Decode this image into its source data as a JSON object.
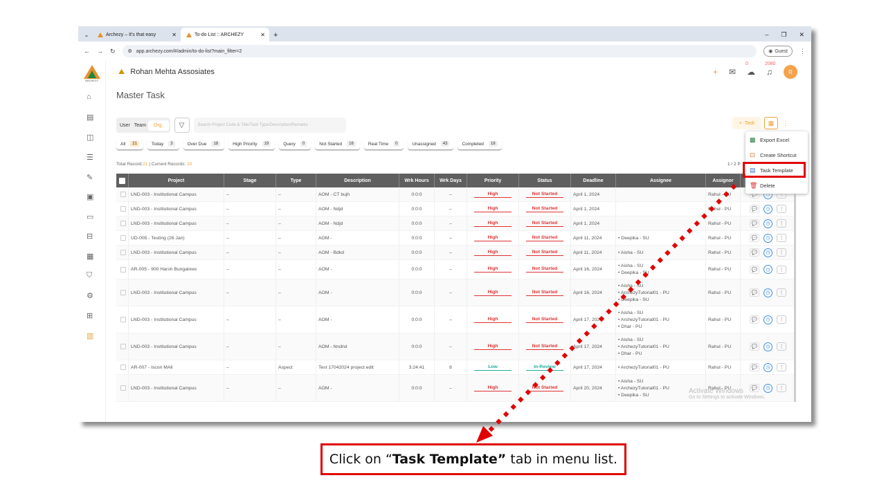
{
  "browser": {
    "tabs": [
      {
        "label": "Archezy – It's that easy",
        "active": false
      },
      {
        "label": "To-do List :: ARCHEZY",
        "active": true
      }
    ],
    "url": "app.archezy.com/#/admin/to-do-list?main_filter=2",
    "profile_label": "Guest"
  },
  "app": {
    "logo_text": "ARCHEZY",
    "company": "Rohan Mehta Assosiates",
    "notif_count": "0",
    "bell_count": "2080",
    "avatar_letter": "R"
  },
  "page": {
    "title": "Master Task",
    "scope_toggle": [
      "User",
      "Team",
      "Org."
    ],
    "search_placeholder": "Search Project Code & Title/Task Type/Description/Remarks",
    "chips": [
      {
        "label": "All",
        "count": "21"
      },
      {
        "label": "Today",
        "count": "3"
      },
      {
        "label": "Over Due",
        "count": "18"
      },
      {
        "label": "High Priority",
        "count": "19"
      },
      {
        "label": "Query",
        "count": "0"
      },
      {
        "label": "Not Started",
        "count": "16"
      },
      {
        "label": "Real Time",
        "count": "0"
      },
      {
        "label": "Unassigned",
        "count": "43"
      },
      {
        "label": "Completed",
        "count": "18"
      }
    ],
    "total_label": "Total Record:",
    "total_value": "21",
    "current_label": " | Current Records: ",
    "current_value": "20",
    "pager": "1 / 2 P",
    "task_button": "Task"
  },
  "menu": {
    "items": [
      {
        "label": "Export Excel",
        "icon": "excel-icon"
      },
      {
        "label": "Create Shortcut",
        "icon": "shortcut-icon"
      },
      {
        "label": "Task Template",
        "icon": "template-icon"
      },
      {
        "label": "Delete",
        "icon": "trash-icon"
      }
    ]
  },
  "table": {
    "headers": [
      "Project",
      "Stage",
      "Type",
      "Description",
      "Wrk Hours",
      "Wrk Days",
      "Priority",
      "Status",
      "Deadline",
      "Assignee",
      "Assignor"
    ],
    "rows": [
      {
        "project": "LND-003 - Institutional Campus",
        "stage": "–",
        "type": "–",
        "desc": "AOM - CT bujh",
        "hours": "0:0:0",
        "days": "–",
        "priority": "High",
        "status": "Not Started",
        "deadline": "April 1, 2024",
        "assignee": [],
        "assignor": "Rahul - PU"
      },
      {
        "project": "LND-003 - Institutional Campus",
        "stage": "–",
        "type": "–",
        "desc": "AOM - Ndjd",
        "hours": "0:0:0",
        "days": "–",
        "priority": "High",
        "status": "Not Started",
        "deadline": "April 1, 2024",
        "assignee": [],
        "assignor": "Rahul - PU"
      },
      {
        "project": "LND-003 - Institutional Campus",
        "stage": "–",
        "type": "–",
        "desc": "AOM - Ndjd",
        "hours": "0:0:0",
        "days": "–",
        "priority": "High",
        "status": "Not Started",
        "deadline": "April 1, 2024",
        "assignee": [],
        "assignor": "Rahul - PU"
      },
      {
        "project": "UD-005 - Testing (26 Jan)",
        "stage": "–",
        "type": "–",
        "desc": "AOM -",
        "hours": "0:0:0",
        "days": "–",
        "priority": "High",
        "status": "Not Started",
        "deadline": "April 11, 2024",
        "assignee": [
          "Deepika - SU"
        ],
        "assignor": "Rahul - PU"
      },
      {
        "project": "LND-003 - Institutional Campus",
        "stage": "–",
        "type": "–",
        "desc": "AOM - Bdkd",
        "hours": "0:0:0",
        "days": "–",
        "priority": "High",
        "status": "Not Started",
        "deadline": "April 11, 2024",
        "assignee": [
          "Aisha - SU"
        ],
        "assignor": "Rahul - PU"
      },
      {
        "project": "AR-005 - 900 Harsh Bungalows",
        "stage": "–",
        "type": "–",
        "desc": "AOM -",
        "hours": "0:0:0",
        "days": "–",
        "priority": "High",
        "status": "Not Started",
        "deadline": "April 16, 2024",
        "assignee": [
          "Aisha - SU",
          "Deepika - SU"
        ],
        "assignor": "Rahul - PU"
      },
      {
        "project": "LND-003 - Institutional Campus",
        "stage": "–",
        "type": "–",
        "desc": "AOM -",
        "hours": "0:0:0",
        "days": "–",
        "priority": "High",
        "status": "Not Started",
        "deadline": "April 16, 2024",
        "assignee": [
          "Aisha - SU",
          "ArchezyTutorial01 - PU",
          "Deepika - SU"
        ],
        "assignor": "Rahul - PU"
      },
      {
        "project": "LND-003 - Institutional Campus",
        "stage": "–",
        "type": "–",
        "desc": "AOM -",
        "hours": "0:0:0",
        "days": "–",
        "priority": "High",
        "status": "Not Started",
        "deadline": "April 17, 2024",
        "assignee": [
          "Aisha - SU",
          "ArchezyTutorial01 - PU",
          "Dhar - PU"
        ],
        "assignor": "Rahul - PU"
      },
      {
        "project": "LND-003 - Institutional Campus",
        "stage": "–",
        "type": "–",
        "desc": "AOM - Nndnd",
        "hours": "0:0:0",
        "days": "–",
        "priority": "High",
        "status": "Not Started",
        "deadline": "April 17, 2024",
        "assignee": [
          "Aisha - SU",
          "ArchezyTutorial01 - PU",
          "Dhar - PU"
        ],
        "assignor": "Rahul - PU"
      },
      {
        "project": "AR-007 - Iscon MAll",
        "stage": "–",
        "type": "Aspect",
        "desc": "Test 17042024 project edit",
        "hours": "3:24:41",
        "days": "8",
        "priority": "Low",
        "status": "In-Review",
        "deadline": "April 17, 2024",
        "assignee": [
          "ArchezyTutorial01 - PU"
        ],
        "assignor": "Rahul - PU"
      },
      {
        "project": "LND-003 - Institutional Campus",
        "stage": "–",
        "type": "–",
        "desc": "AOM -",
        "hours": "0:0:0",
        "days": "–",
        "priority": "High",
        "status": "Not Started",
        "deadline": "April 20, 2024",
        "assignee": [
          "Aisha - SU",
          "ArchezyTutorial01 - PU",
          "Deepika - SU"
        ],
        "assignor": "Rahul - PU"
      }
    ]
  },
  "watermark": {
    "title": "Activate Windows",
    "sub": "Go to Settings to activate Windows."
  },
  "instruction": {
    "pre": "Click on “",
    "bold": "Task Template”",
    "post": " tab in menu list."
  },
  "colors": {
    "accent": "#f0a030",
    "highlight": "#e00000",
    "header": "#5f5f5f"
  }
}
